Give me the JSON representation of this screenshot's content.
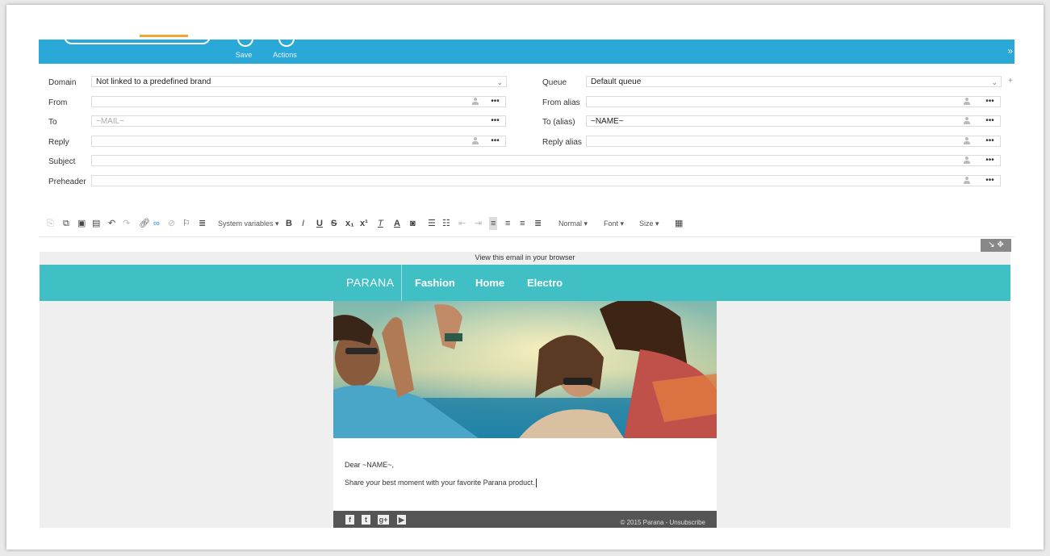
{
  "toolbar": {
    "save_label": "Save",
    "actions_label": "Actions",
    "collapse_glyph": "»"
  },
  "form": {
    "domain_label": "Domain",
    "domain_value": "Not linked to a predefined brand",
    "queue_label": "Queue",
    "queue_value": "Default queue",
    "from_label": "From",
    "from_value": "",
    "from_alias_label": "From alias",
    "from_alias_value": "",
    "to_label": "To",
    "to_value": "~MAIL~",
    "to_alias_label": "To (alias)",
    "to_alias_value": "~NAME~",
    "reply_label": "Reply",
    "reply_value": "",
    "reply_alias_label": "Reply alias",
    "reply_alias_value": "",
    "subject_label": "Subject",
    "subject_value": "",
    "preheader_label": "Preheader",
    "preheader_value": "",
    "more_glyph": "•••",
    "add_glyph": "+"
  },
  "editor": {
    "system_variables_label": "System variables",
    "format_label": "Normal",
    "font_label": "Font",
    "size_label": "Size",
    "dropdown_glyph": "▾"
  },
  "email": {
    "view_in_browser": "View this email in your browser",
    "brand": "PARANA",
    "nav": [
      "Fashion",
      "Home",
      "Electro"
    ],
    "greeting": "Dear ~NAME~,",
    "message": "Share your best moment with your favorite Parana product.",
    "footer_copy": "© 2015 Parana - Unsubscribe"
  },
  "colors": {
    "topbar": "#2aa8d8",
    "accent": "#f0a830",
    "nav": "#40c0c4",
    "footer": "#555555"
  }
}
